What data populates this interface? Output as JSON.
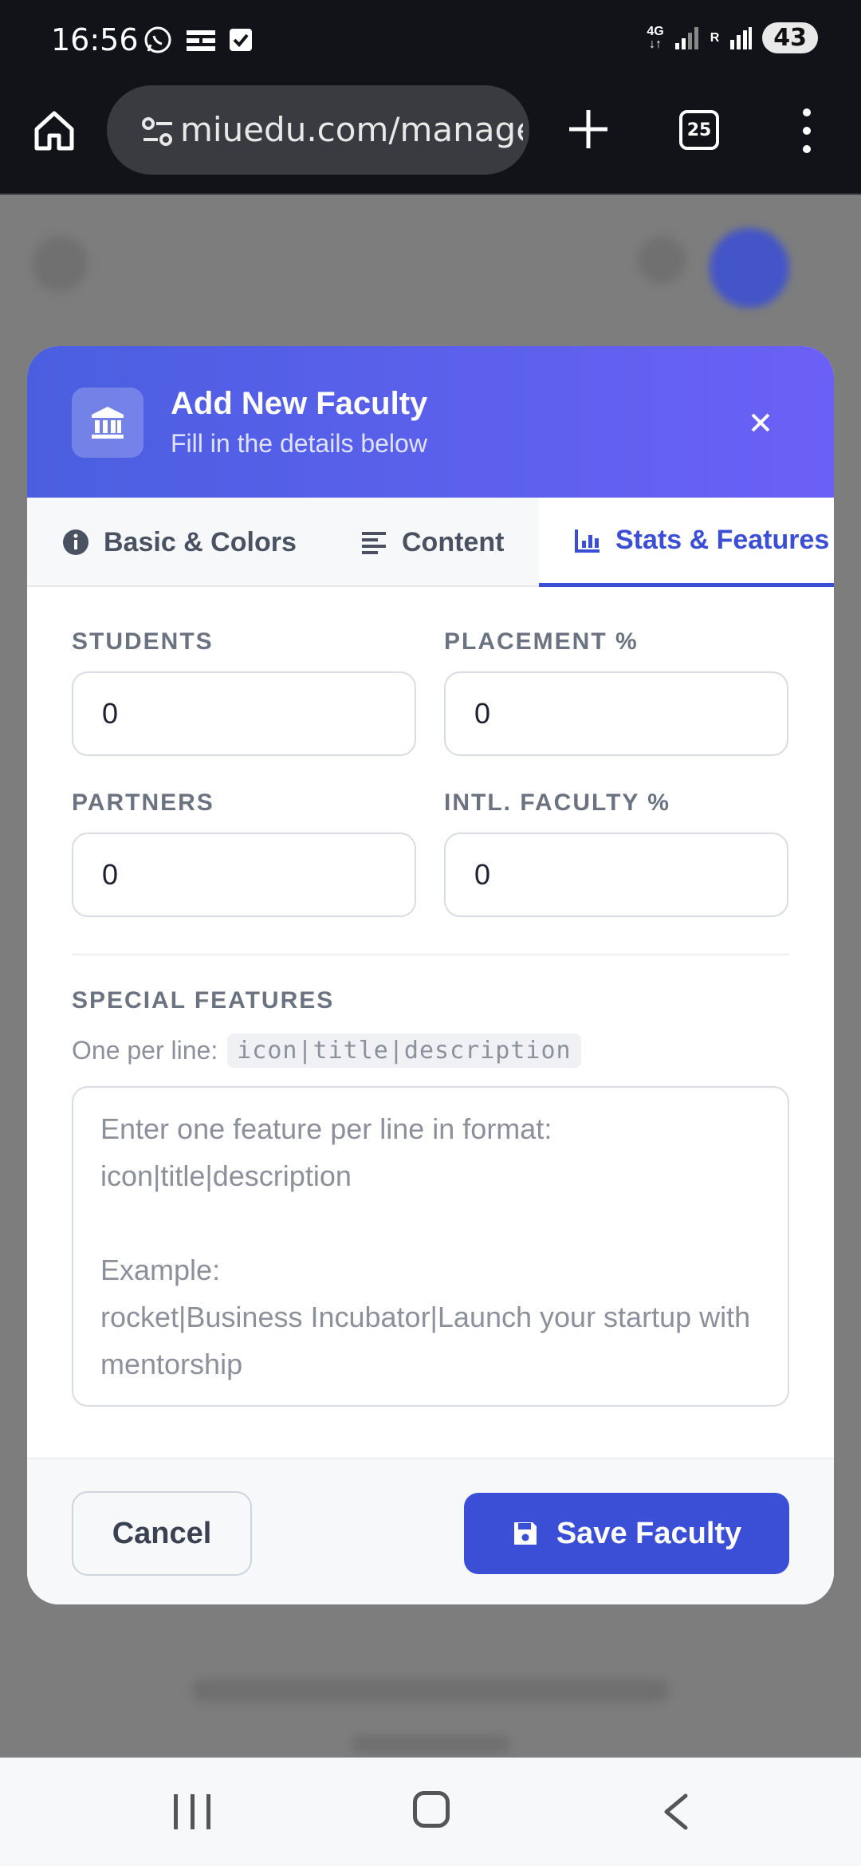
{
  "status_bar": {
    "time": "16:56",
    "network": "4G",
    "roaming": "R",
    "battery": "43"
  },
  "browser": {
    "url": "miuedu.com/manage",
    "tab_count": "25"
  },
  "modal": {
    "title": "Add New Faculty",
    "subtitle": "Fill in the details below",
    "tabs": [
      {
        "label": "Basic & Colors",
        "icon": "info-icon"
      },
      {
        "label": "Content",
        "icon": "align-left-icon"
      },
      {
        "label": "Stats & Features",
        "icon": "bar-chart-icon",
        "active": true
      }
    ],
    "fields": {
      "students": {
        "label": "STUDENTS",
        "value": "0"
      },
      "placement": {
        "label": "PLACEMENT %",
        "value": "0"
      },
      "partners": {
        "label": "PARTNERS",
        "value": "0"
      },
      "intl_faculty": {
        "label": "INTL. FACULTY %",
        "value": "0"
      }
    },
    "special_features": {
      "label": "SPECIAL FEATURES",
      "hint_prefix": "One per line:",
      "hint_code": "icon|title|description",
      "placeholder": "Enter one feature per line in format:\nicon|title|description\n\nExample:\nrocket|Business Incubator|Launch your startup with mentorship"
    },
    "footer": {
      "cancel_label": "Cancel",
      "save_label": "Save Faculty"
    }
  },
  "colors": {
    "primary": "#3b4fd6",
    "header_gradient_start": "#4a5fe0",
    "header_gradient_end": "#6b60f6"
  }
}
